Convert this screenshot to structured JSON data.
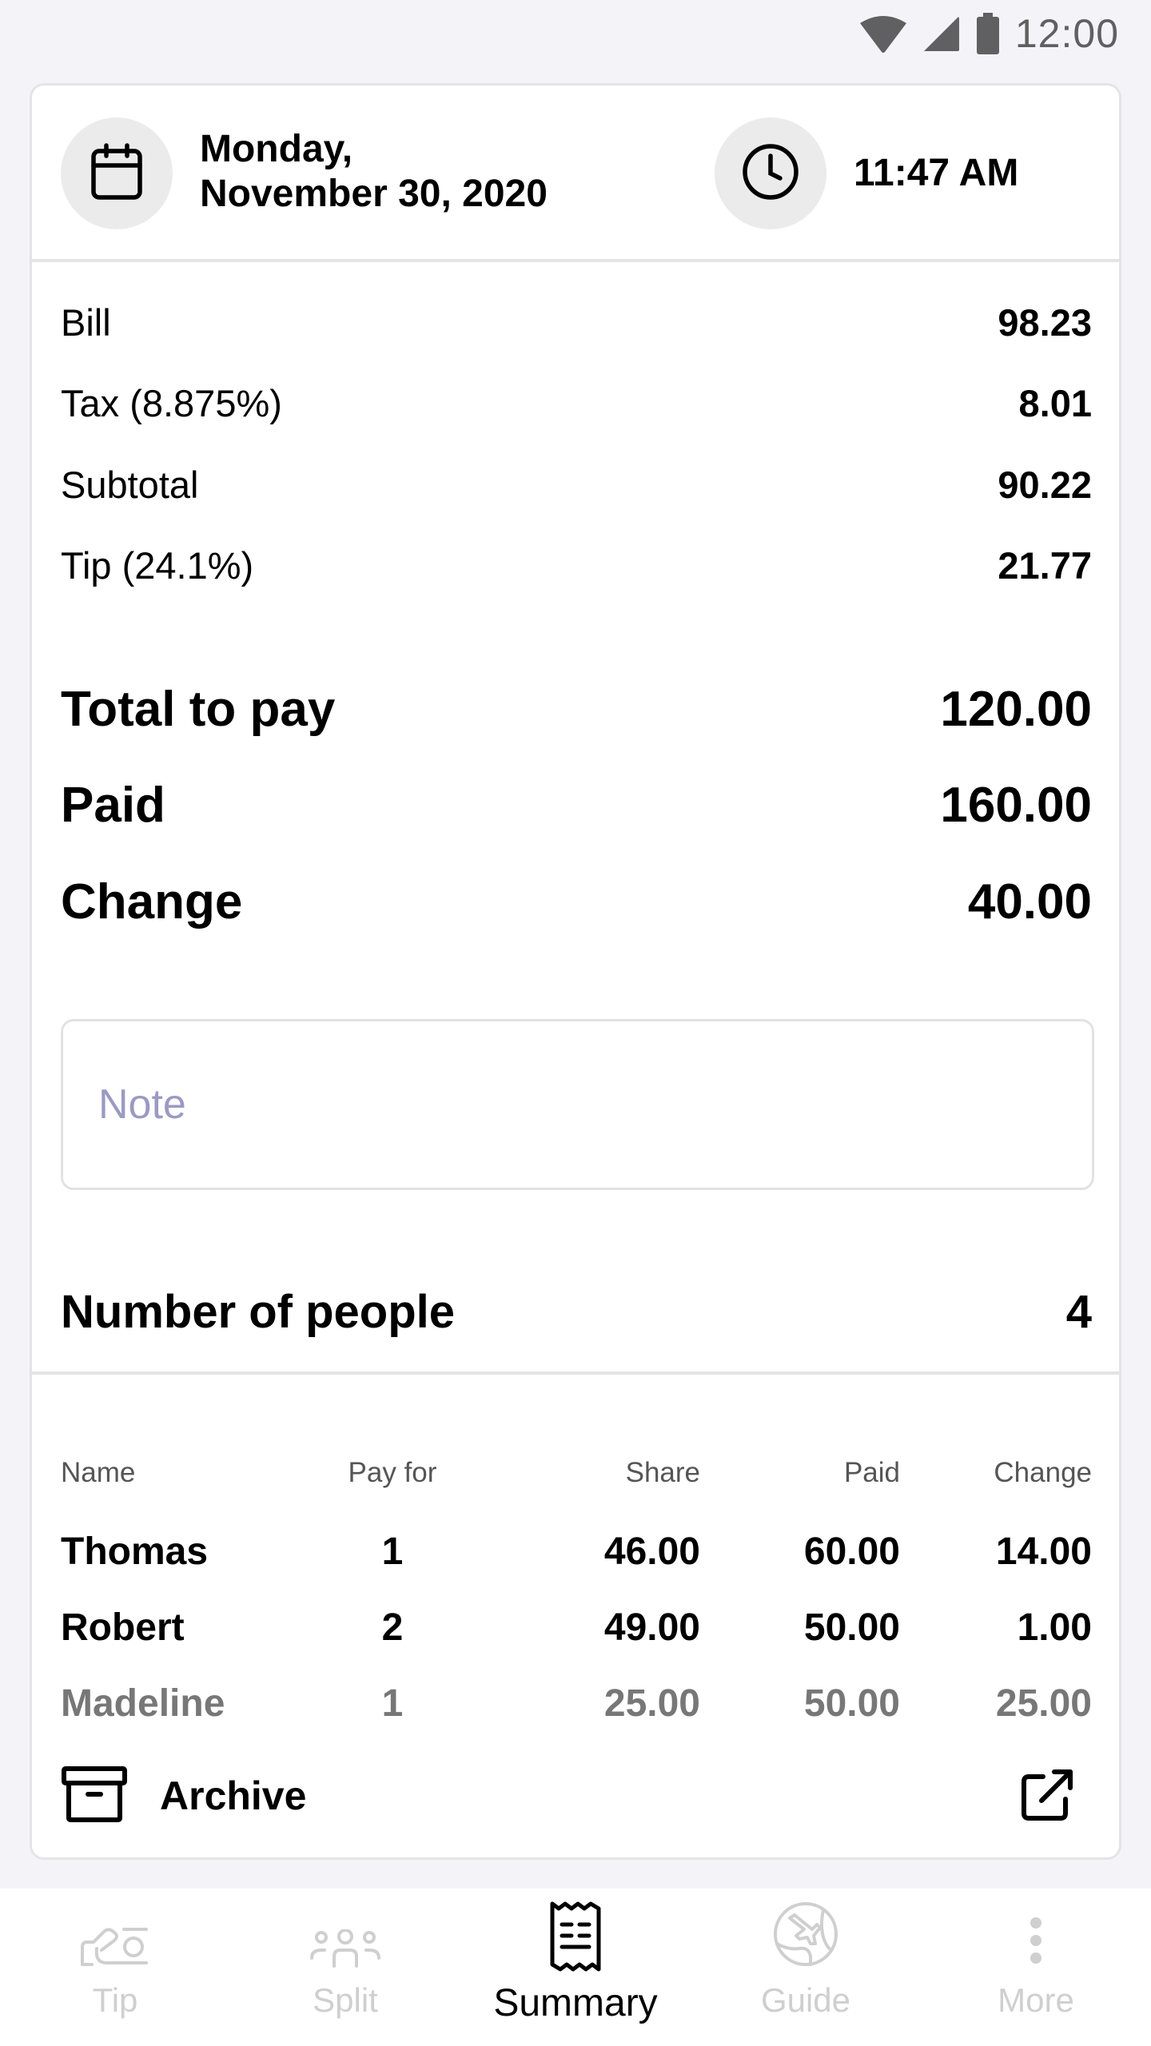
{
  "status_bar": {
    "time": "12:00",
    "icons": [
      "wifi-icon",
      "cellular-signal-icon",
      "battery-icon"
    ]
  },
  "header": {
    "date_line1": "Monday,",
    "date_line2": "November 30, 2020",
    "time": "11:47 AM",
    "date_icon": "calendar-icon",
    "time_icon": "clock-icon"
  },
  "breakdown": [
    {
      "label": "Bill",
      "value": "98.23"
    },
    {
      "label": "Tax (8.875%)",
      "value": "8.01"
    },
    {
      "label": "Subtotal",
      "value": "90.22"
    },
    {
      "label": "Tip (24.1%)",
      "value": "21.77"
    }
  ],
  "totals": [
    {
      "label": "Total to pay",
      "value": "120.00"
    },
    {
      "label": "Paid",
      "value": "160.00"
    },
    {
      "label": "Change",
      "value": "40.00"
    }
  ],
  "note": {
    "placeholder": "Note",
    "value": ""
  },
  "people": {
    "label": "Number of people",
    "count": "4"
  },
  "split_table": {
    "columns": [
      "Name",
      "Pay for",
      "Share",
      "Paid",
      "Change"
    ],
    "rows": [
      {
        "name": "Thomas",
        "pay_for": "1",
        "share": "46.00",
        "paid": "60.00",
        "change": "14.00"
      },
      {
        "name": "Robert",
        "pay_for": "2",
        "share": "49.00",
        "paid": "50.00",
        "change": "1.00"
      },
      {
        "name": "Madeline",
        "pay_for": "1",
        "share": "25.00",
        "paid": "50.00",
        "change": "25.00"
      }
    ]
  },
  "actions": {
    "archive_label": "Archive",
    "archive_icon": "archive-box-icon",
    "share_icon": "external-share-icon"
  },
  "bottom_nav": {
    "items": [
      {
        "label": "Tip",
        "icon": "hand-coin-icon",
        "active": false
      },
      {
        "label": "Split",
        "icon": "group-people-icon",
        "active": false
      },
      {
        "label": "Summary",
        "icon": "receipt-icon",
        "active": true
      },
      {
        "label": "Guide",
        "icon": "globe-plane-icon",
        "active": false
      },
      {
        "label": "More",
        "icon": "more-vertical-icon",
        "active": false
      }
    ]
  },
  "colors": {
    "background": "#f4f4f8",
    "card": "#ffffff",
    "border": "#e4e4e6",
    "icon_circle": "#ebebeb",
    "placeholder": "#9a9ac2",
    "inactive_nav": "#cfcfcf",
    "active_nav": "#000000"
  }
}
